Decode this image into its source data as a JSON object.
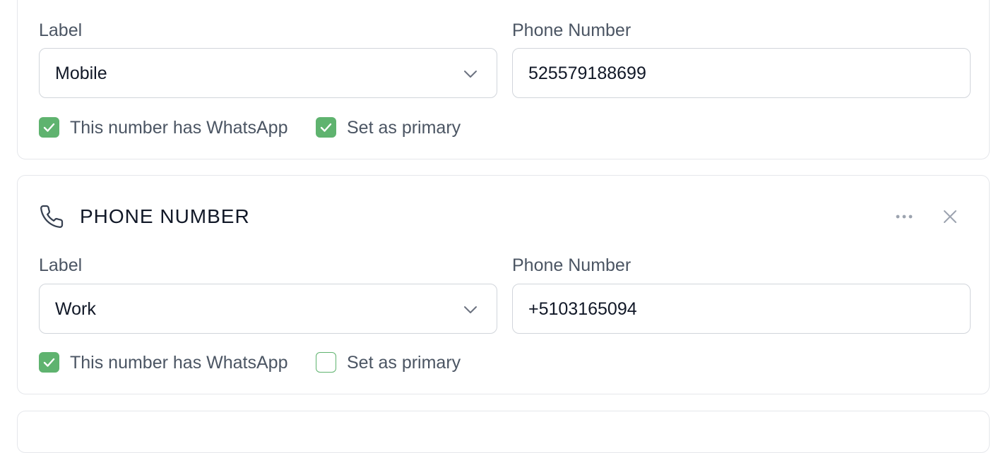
{
  "cards": [
    {
      "label_field": {
        "label": "Label",
        "value": "Mobile"
      },
      "phone_field": {
        "label": "Phone Number",
        "value": "525579188699"
      },
      "whatsapp": {
        "label": "This number has WhatsApp",
        "checked": true
      },
      "primary": {
        "label": "Set as primary",
        "checked": true
      }
    },
    {
      "title": "PHONE NUMBER",
      "label_field": {
        "label": "Label",
        "value": "Work"
      },
      "phone_field": {
        "label": "Phone Number",
        "value": "+5103165094"
      },
      "whatsapp": {
        "label": "This number has WhatsApp",
        "checked": true
      },
      "primary": {
        "label": "Set as primary",
        "checked": false
      }
    }
  ],
  "icons": {
    "section": "phone-icon",
    "more": "more-horizontal-icon",
    "close": "close-icon",
    "dropdown": "chevron-down-icon",
    "check": "check-icon"
  },
  "colors": {
    "accent_green": "#5fb36f",
    "border": "#e5e7eb",
    "text_primary": "#111827",
    "text_secondary": "#4b5563"
  }
}
